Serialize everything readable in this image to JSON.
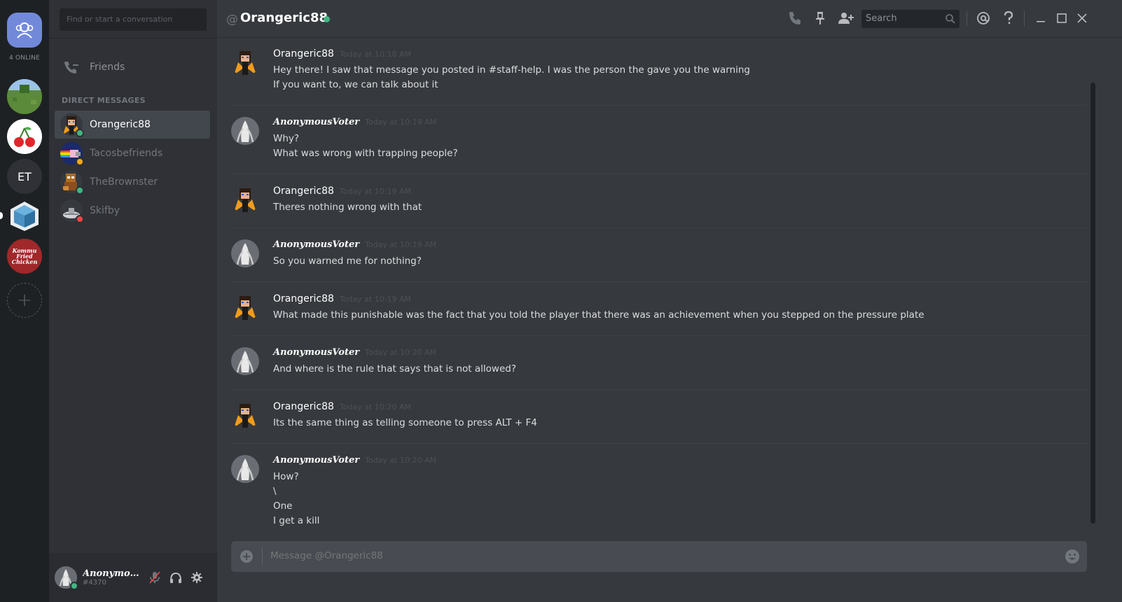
{
  "servers": {
    "online_count": "4 ONLINE",
    "items": [
      {
        "name": "server-grassland",
        "color": "#5c8a3c"
      },
      {
        "name": "server-cherry",
        "color": "#ffffff"
      },
      {
        "name": "server-et",
        "label": "ET"
      },
      {
        "name": "server-cube",
        "color": "#4a90c2"
      },
      {
        "name": "server-kommu",
        "label": "Kommu Fried Chicken",
        "color": "#a0282a"
      }
    ],
    "add_label": "+"
  },
  "dm": {
    "search_placeholder": "Find or start a conversation",
    "friends_label": "Friends",
    "header": "DIRECT MESSAGES",
    "items": [
      {
        "name": "Orangeric88",
        "status": "online",
        "active": true
      },
      {
        "name": "Tacosbefriends",
        "status": "idle"
      },
      {
        "name": "TheBrownster",
        "status": "online"
      },
      {
        "name": "Skifby",
        "status": "dnd"
      }
    ]
  },
  "user": {
    "name": "AnonymousVoter",
    "tag": "#4370"
  },
  "topbar": {
    "at": "@",
    "channel": "Orangeric88",
    "search_placeholder": "Search"
  },
  "messages": [
    {
      "author": "Orangeric88",
      "style": "normal",
      "time": "Today at 10:18 AM",
      "lines": [
        "Hey there! I saw that message you posted in #staff-help. I was the person the gave you the warning",
        "If you want to, we can talk about it"
      ]
    },
    {
      "author": "AnonymousVoter",
      "style": "anon",
      "time": "Today at 10:19 AM",
      "lines": [
        "Why?",
        "What was wrong with trapping people?"
      ]
    },
    {
      "author": "Orangeric88",
      "style": "normal",
      "time": "Today at 10:19 AM",
      "lines": [
        "Theres nothing wrong with that"
      ]
    },
    {
      "author": "AnonymousVoter",
      "style": "anon",
      "time": "Today at 10:19 AM",
      "lines": [
        "So you warned me for nothing?"
      ]
    },
    {
      "author": "Orangeric88",
      "style": "normal",
      "time": "Today at 10:19 AM",
      "lines": [
        "What made this punishable was the fact that you told the player that there was an achievement when you stepped on the pressure plate"
      ]
    },
    {
      "author": "AnonymousVoter",
      "style": "anon",
      "time": "Today at 10:20 AM",
      "lines": [
        "And where is the rule that says that is not allowed?"
      ]
    },
    {
      "author": "Orangeric88",
      "style": "normal",
      "time": "Today at 10:20 AM",
      "lines": [
        "Its the same thing as telling someone to press ALT + F4"
      ]
    },
    {
      "author": "AnonymousVoter",
      "style": "anon",
      "time": "Today at 10:20 AM",
      "lines": [
        "How?",
        "\\",
        "One",
        "I get a kill"
      ]
    }
  ],
  "composer": {
    "placeholder": "Message @Orangeric88"
  },
  "colors": {
    "online": "#43b581",
    "idle": "#faa61a",
    "dnd": "#f04747",
    "blurple": "#7289da"
  }
}
